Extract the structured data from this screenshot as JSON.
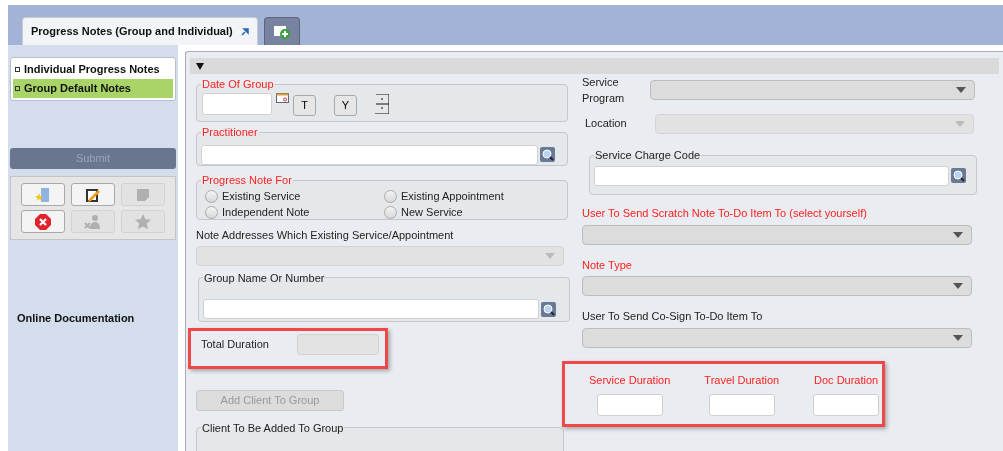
{
  "tabs": [
    {
      "label": "Progress Notes (Group and Individual)",
      "selected": true
    }
  ],
  "nav": [
    {
      "label": "Individual Progress Notes",
      "selected": false
    },
    {
      "label": "Group Default Notes",
      "selected": true
    }
  ],
  "submit": {
    "label": "Submit",
    "disabled": true
  },
  "toolbar": [
    {
      "kind": "folder",
      "disabled": false
    },
    {
      "kind": "pencil",
      "disabled": false
    },
    {
      "kind": "note",
      "disabled": true
    },
    {
      "kind": "close",
      "disabled": false
    },
    {
      "kind": "people",
      "disabled": true
    },
    {
      "kind": "star",
      "disabled": true
    }
  ],
  "online_documentation": "Online Documentation",
  "date_of_group": {
    "label": "Date Of Group",
    "required": true,
    "buttons": [
      "T",
      "Y"
    ]
  },
  "practitioner": {
    "label": "Practitioner",
    "required": true
  },
  "progress_note_for": {
    "label": "Progress Note For",
    "required": true,
    "options": [
      {
        "label": "Existing Service",
        "selected": false
      },
      {
        "label": "Existing Appointment",
        "selected": false
      },
      {
        "label": "Independent Note",
        "selected": false
      },
      {
        "label": "New Service",
        "selected": false
      }
    ]
  },
  "note_addresses": {
    "label": "Note Addresses Which Existing Service/Appointment",
    "disabled": true
  },
  "group_name": {
    "label": "Group Name Or Number",
    "required": false
  },
  "total_duration": {
    "label": "Total Duration",
    "disabled": true
  },
  "add_client": {
    "label": "Add Client To Group",
    "disabled": true
  },
  "client_to_add": {
    "label": "Client To Be Added To Group"
  },
  "service_program": {
    "label": "Service Program",
    "disabled": false
  },
  "location": {
    "label": "Location",
    "disabled": true
  },
  "service_charge_code": {
    "label": "Service Charge Code",
    "required": false
  },
  "scratch_user": {
    "label": "User To Send Scratch Note To-Do Item To (select yourself)",
    "required": true
  },
  "note_type": {
    "label": "Note Type",
    "required": true
  },
  "cosign_user": {
    "label": "User To Send Co-Sign To-Do Item To",
    "required": false
  },
  "durations": [
    {
      "label": "Service Duration",
      "required": true
    },
    {
      "label": "Travel Duration",
      "required": true
    },
    {
      "label": "Doc Duration",
      "required": true
    }
  ]
}
